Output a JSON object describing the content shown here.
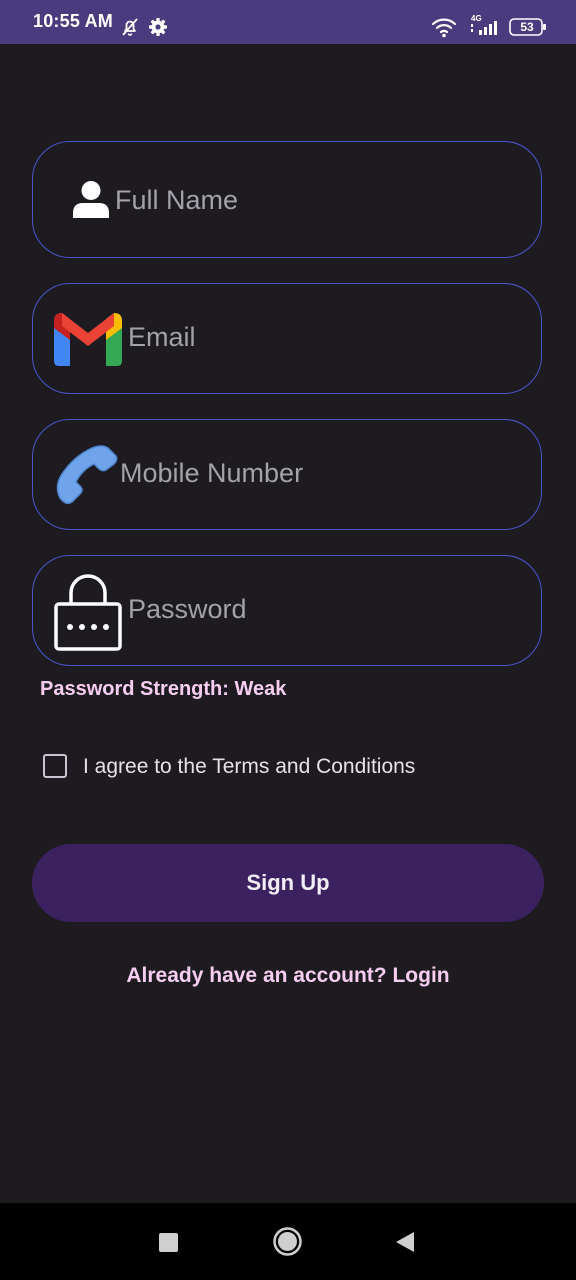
{
  "status_bar": {
    "time": "10:55 AM",
    "network": "4G",
    "battery": "53",
    "icons": [
      "bell-off-icon",
      "gear-icon",
      "wifi-icon",
      "signal-icon",
      "battery-icon"
    ]
  },
  "form": {
    "full_name": {
      "placeholder": "Full Name",
      "icon": "person-icon"
    },
    "email": {
      "placeholder": "Email",
      "icon": "gmail-icon"
    },
    "mobile": {
      "placeholder": "Mobile Number",
      "icon": "phone-icon"
    },
    "password": {
      "placeholder": "Password",
      "icon": "lock-icon"
    }
  },
  "password_strength": "Password Strength: Weak",
  "terms": {
    "label": "I agree to the Terms and Conditions",
    "checked": false
  },
  "signup_button": "Sign Up",
  "login_link": "Already have an account? Login",
  "nav": {
    "icons": [
      "recents-icon",
      "home-icon",
      "back-icon"
    ]
  },
  "colors": {
    "background": "#1d1b20",
    "status_bar": "#4a3a7e",
    "field_border": "#4a54c9",
    "button": "#3b2160",
    "accent_text": "#f7cdf1"
  }
}
